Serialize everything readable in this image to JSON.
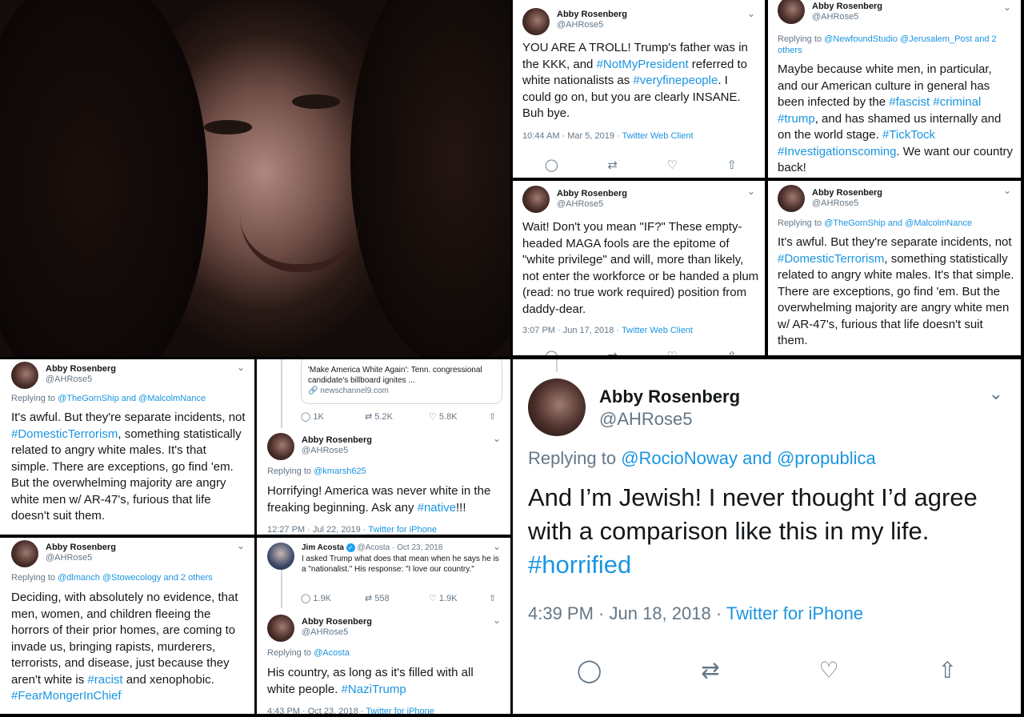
{
  "account": {
    "name": "Abby Rosenberg",
    "handle": "@AHRose5"
  },
  "tweet1": {
    "body_parts": [
      "YOU ARE A TROLL!  Trump's father was in the KKK, and ",
      "#NotMyPresident",
      " referred to white nationalists as ",
      "#veryfinepeople",
      ". I could go on, but you are clearly INSANE. Buh bye."
    ],
    "time": "10:44 AM · Mar 5, 2019 · ",
    "source": "Twitter Web Client"
  },
  "tweet2": {
    "reply_prefix": "Replying to ",
    "reply_links": "@NewfoundStudio @Jerusalem_Post and 2 others",
    "body_parts": [
      "Maybe because white men, in particular, and our American culture in general has been infected by the ",
      "#fascist",
      " ",
      "#criminal",
      " ",
      "#trump",
      ", and has shamed us internally and on the world stage. ",
      "#TickTock",
      " ",
      "#Investigationscoming",
      ". We want our country back!"
    ]
  },
  "tweet3": {
    "body_parts": [
      "Wait! Don't you mean \"IF?\" These empty-headed MAGA fools are the epitome of \"white privilege\" and will, more than likely, not enter the workforce or be handed a plum (read: no true work required) position from daddy-dear."
    ],
    "time": "3:07 PM · Jun 17, 2018 · ",
    "source": "Twitter Web Client"
  },
  "tweet4": {
    "reply_prefix": "Replying to ",
    "reply_links": "@TheGornShip and @MalcolmNance",
    "body_parts": [
      "It's awful. But they're separate incidents, not ",
      "#DomesticTerrorism",
      ", something statistically related to angry white males. It's that simple. There are exceptions, go find 'em. But the overwhelming majority are angry white men w/ AR-47's, furious that life doesn't suit them."
    ]
  },
  "tweet5": {
    "reply_prefix": "Replying to ",
    "reply_links": "@TheGornShip and @MalcolmNance",
    "body_parts": [
      "It's awful. But they're separate incidents, not ",
      "#DomesticTerrorism",
      ", something statistically related to angry white males. It's that simple. There are exceptions, go find 'em. But the overwhelming majority are angry white men w/ AR-47's, furious that life doesn't suit them."
    ]
  },
  "tweet6": {
    "card_title": "'Make America White Again': Tenn. congressional candidate's billboard ignites ...",
    "card_link": "newschannel9.com",
    "counts": [
      "1K",
      "5.2K",
      "5.8K"
    ],
    "reply_prefix": "Replying to ",
    "reply_links": "@kmarsh625",
    "body_parts": [
      "Horrifying! America was never white in the freaking beginning. Ask any ",
      "#native",
      "!!!"
    ],
    "time": "12:27 PM · Jul 22, 2019 · ",
    "source": "Twitter for iPhone"
  },
  "tweet7": {
    "reply_prefix": "Replying to ",
    "reply_links": "@dlmanch @Stowecology and 2 others",
    "body_parts": [
      "Deciding, with absolutely no evidence, that men, women, and children fleeing the horrors of their prior homes, are coming to invade us, bringing rapists, murderers, terrorists, and disease, just because they aren't white is ",
      "#racist",
      " and xenophobic. ",
      "#FearMongerInChief",
      ""
    ]
  },
  "tweet8": {
    "quoted_name": "Jim Acosta",
    "quoted_handle": "@Acosta · Oct 23, 2018",
    "quoted_body": "I asked Trump what does that mean when he says he is a \"nationalist.\" His response: \"I love our country.\"",
    "counts": [
      "1.9K",
      "558",
      "1.9K"
    ],
    "reply_prefix": "Replying to ",
    "reply_links": "@Acosta",
    "body_parts": [
      "His country, as long as it's filled with all white people. ",
      "#NaziTrump",
      ""
    ],
    "time": "4:43 PM · Oct 23, 2018 · ",
    "source": "Twitter for iPhone"
  },
  "tweet9": {
    "reply_prefix": "Replying to ",
    "reply_links": "@RocioNoway and @propublica",
    "body_parts": [
      "And I’m Jewish! I never thought I’d agree with a comparison like this in my life. ",
      "#horrified",
      ""
    ],
    "time": "4:39 PM · Jun 18, 2018 · ",
    "source": "Twitter for iPhone"
  },
  "icons": [
    "reply-icon",
    "retweet-icon",
    "like-icon",
    "share-icon",
    "chevron-down-icon",
    "link-icon"
  ],
  "colors": {
    "link": "#1b95e0",
    "text": "#14171a",
    "muted": "#657786",
    "border": "#ccd6dd"
  }
}
